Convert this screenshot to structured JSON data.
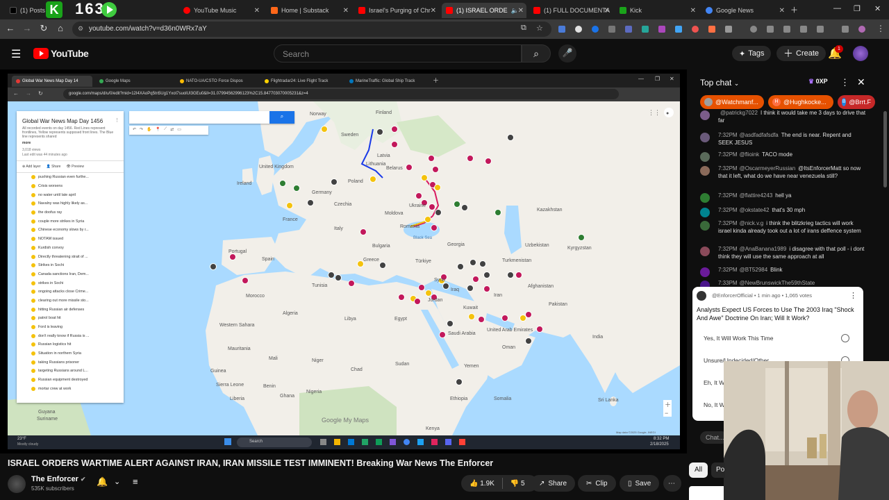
{
  "browser": {
    "tabs": [
      {
        "label": "(1) Posts /",
        "active": false
      },
      {
        "label": "YouTube Music",
        "active": false
      },
      {
        "label": "Home | Substack",
        "active": false
      },
      {
        "label": "Israel's Purging of Chr",
        "active": false
      },
      {
        "label": "(1) ISRAEL ORDE",
        "active": true
      },
      {
        "label": "(1) FULL DOCUMENTA",
        "active": false
      },
      {
        "label": "Kick",
        "active": false
      },
      {
        "label": "Google News",
        "active": false
      }
    ],
    "overlay_counter": "163",
    "url": "youtube.com/watch?v=d36n0WRx7aY"
  },
  "youtube": {
    "logo": "YouTube",
    "search_placeholder": "Search",
    "tags_label": "Tags",
    "create_label": "Create",
    "notif_count": "1"
  },
  "video_screen": {
    "inner_tabs": [
      {
        "label": "Global War News Map Day 14"
      },
      {
        "label": "Google Maps"
      },
      {
        "label": "NATO-UA/CSTO Force Dispos"
      },
      {
        "label": "Flightradar24: Live Flight Track"
      },
      {
        "label": "MarineTraffic: Global Ship Track"
      }
    ],
    "inner_url": "google.com/maps/d/u/0/edit?mid=12I4XAoPq5tn5Ug1Yxot7suolUI3GEu0&ll=31.07994562996123%2C15.847703070005231&z=4",
    "map_panel": {
      "title": "Global War News Map Day 1456",
      "description": "All recorded events on day 1456. Red Lines represent frontlines, Yellow represents supposed front lines. The Blue line represents shared",
      "more": "more",
      "views": "3,018 views",
      "last_edit": "Last edit was 44 minutes ago",
      "add_layer": "Add layer",
      "share": "Share",
      "preview": "Preview",
      "items": [
        "pushing Russian even furthe...",
        "Crisis worsens",
        "no water until late april",
        "Navalny was highly likely as...",
        "the doofus ray",
        "couple more strikes in Syria",
        "Chinese economy slows by r...",
        "NOTAM issued",
        "Kurdish convoy",
        "Directly threatening strait of ...",
        "Strikes in Sochi",
        "Canada sanctions Iran, Dem...",
        "strikes in Sochi",
        "ongoing attacks close Crime...",
        "clearing out more missile sto...",
        "hitting Russian air defenses",
        "patrol boat hit",
        "Ford is leaving",
        "don't really know if Russia is ...",
        "Russian logistics hit",
        "Situation in northern Syria",
        "taking Russians prisoner",
        "targeting Russians around L...",
        "Russian equipment destroyed",
        "mortar crew at work"
      ]
    },
    "map_labels": [
      "Norway",
      "Finland",
      "Sweden",
      "United Kingdom",
      "Ireland",
      "Germany",
      "Poland",
      "Belarus",
      "France",
      "Czechia",
      "Ukraine",
      "Moldova",
      "Romania",
      "Italy",
      "Spain",
      "Portugal",
      "Bulgaria",
      "Greece",
      "Türkiye",
      "Georgia",
      "Kazakhstan",
      "Uzbekistan",
      "Kyrgyzstan",
      "Turkmenistan",
      "Afghanistan",
      "Pakistan",
      "India",
      "Iran",
      "Iraq",
      "Syria",
      "Jordan",
      "Kuwait",
      "Saudi Arabia",
      "United Arab Emirates",
      "Oman",
      "Yemen",
      "Egypt",
      "Libya",
      "Tunisia",
      "Algeria",
      "Morocco",
      "Western Sahara",
      "Mauritania",
      "Mali",
      "Niger",
      "Chad",
      "Sudan",
      "Ethiopia",
      "Kenya",
      "Somalia",
      "Nigeria",
      "Guinea",
      "Ghana",
      "Sierra Leone",
      "Liberia",
      "Sri Lanka",
      "Guyana",
      "Suriname",
      "Latvia",
      "Lithuania",
      "Black Sea",
      "Benin"
    ],
    "map_footer": "Map data ©2025 Google, INEGI",
    "google_watermark": "Google My Maps",
    "weather_temp": "23°F",
    "weather_desc": "Mostly cloudy",
    "taskbar_search": "Search",
    "clock_time": "8:32 PM",
    "clock_date": "2/18/2025"
  },
  "chat": {
    "header": "Top chat",
    "donors": [
      {
        "label": "@Watchmanf...",
        "color": "#e65100"
      },
      {
        "label": "@Hughkocke...",
        "color": "#e65100"
      },
      {
        "label": "@Brrt.F",
        "color": "#c62828"
      }
    ],
    "xp_label": "0XP",
    "messages": [
      {
        "time": "",
        "author": "@patrickg7022",
        "text": "I think it would take me 3 days to drive that far",
        "color": "#7b5c8a"
      },
      {
        "time": "7:32PM",
        "author": "@asdfadfafsdfa",
        "text": "The end is near. Repent and SEEK JESUS",
        "color": "#6a5a7a"
      },
      {
        "time": "7:32PM",
        "author": "@flioink",
        "text": "TACO mode",
        "color": "#5a6a5a"
      },
      {
        "time": "7:32PM",
        "author": "@OscarmeyerRussian",
        "text": "@ItsEnforcerMatt so now that it left, what do we have near venezuela still?",
        "color": "#8a6a5a"
      },
      {
        "time": "7:32PM",
        "author": "@flattire4243",
        "text": "hell ya",
        "color": "#2e7d32"
      },
      {
        "time": "7:32PM",
        "author": "@okstate42",
        "text": "that's 30 mph",
        "color": "#00838f"
      },
      {
        "time": "7:32PM",
        "author": "@nick.v.g",
        "text": "i think the blitzkrieg tactics will work israel kinda already took out a lot of irans deffence system",
        "color": "#3a6a3a"
      },
      {
        "time": "7:32PM",
        "author": "@AnaBanana1989",
        "text": "i disagree with that poll - i dont think they will use the same approach at all",
        "color": "#8a4a5a"
      },
      {
        "time": "7:32PM",
        "author": "@BT52984",
        "text": "Blink",
        "color": "#6a1b9a"
      },
      {
        "time": "7:33PM",
        "author": "@NewBrunswickThe59thState",
        "text": "",
        "color": "#4a148c"
      }
    ],
    "poll": {
      "author": "@EnforcerOfficial",
      "meta": "1 min ago • 1,065 votes",
      "question": "Analysts Expect US Forces to Use The 2003 Iraq \"Shock And Awe\" Doctrine On Iran; Will It Work?",
      "options": [
        "Yes, It Will Work This Time",
        "Unsure/Undecided/Other",
        "Eh, It W",
        "No, It W"
      ]
    },
    "input_placeholder": "Chat..."
  },
  "video": {
    "title": "ISRAEL ORDERS WARTIME ALERT AGAINST IRAN, IRAN MISSILE TEST IMMINENT! Breaking War News The Enforcer",
    "channel": "The Enforcer",
    "subscribers": "535K subscribers",
    "likes": "1.9K",
    "dislikes": "5",
    "share": "Share",
    "clip": "Clip",
    "save": "Save"
  },
  "filters": {
    "all": "All",
    "second": "Po"
  },
  "colors": {
    "accent": "#ff0000",
    "map_water": "#aadaff",
    "map_land": "#f2efe9",
    "poll_bg": "#ffffff"
  }
}
